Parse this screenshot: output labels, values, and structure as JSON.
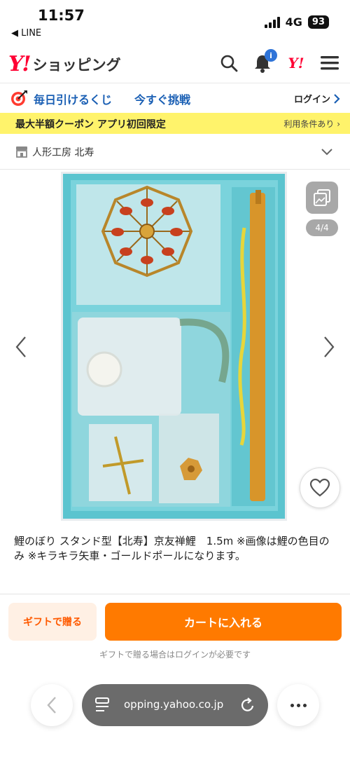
{
  "status_bar": {
    "time": "11:57",
    "back_app": "◀ LINE",
    "network": "4G",
    "battery": "93"
  },
  "header": {
    "logo_mark": "Y!",
    "logo_text": "ショッピング",
    "notification_badge": "i",
    "yahoo_mark": "Y!",
    "icons": [
      "search-icon",
      "bell-icon",
      "yahoo-logo-icon",
      "menu-icon"
    ]
  },
  "lottery": {
    "text": "毎日引けるくじ",
    "cta": "今すぐ挑戦",
    "login": "ログイン"
  },
  "coupon": {
    "text": "最大半額クーポン アプリ初回限定",
    "terms": "利用条件あり ›"
  },
  "store": {
    "name": "人形工房 北寿"
  },
  "gallery": {
    "counter": "4/4"
  },
  "product": {
    "title": "鯉のぼり スタンド型【北寿】京友禅鯉　1.5m ※画像は鯉の色目のみ ※キラキラ矢車・ゴールドポールになります。"
  },
  "actions": {
    "gift_label": "ギフトで贈る",
    "cart_label": "カートに入れる",
    "gift_note": "ギフトで贈る場合はログインが必要です"
  },
  "browser": {
    "url": "opping.yahoo.co.jp"
  },
  "colors": {
    "brand_red": "#ff0033",
    "link_blue": "#1a5fb4",
    "coupon_yellow": "#fff36b",
    "cart_orange": "#ff7a00",
    "gift_bg": "#fff0e4"
  }
}
